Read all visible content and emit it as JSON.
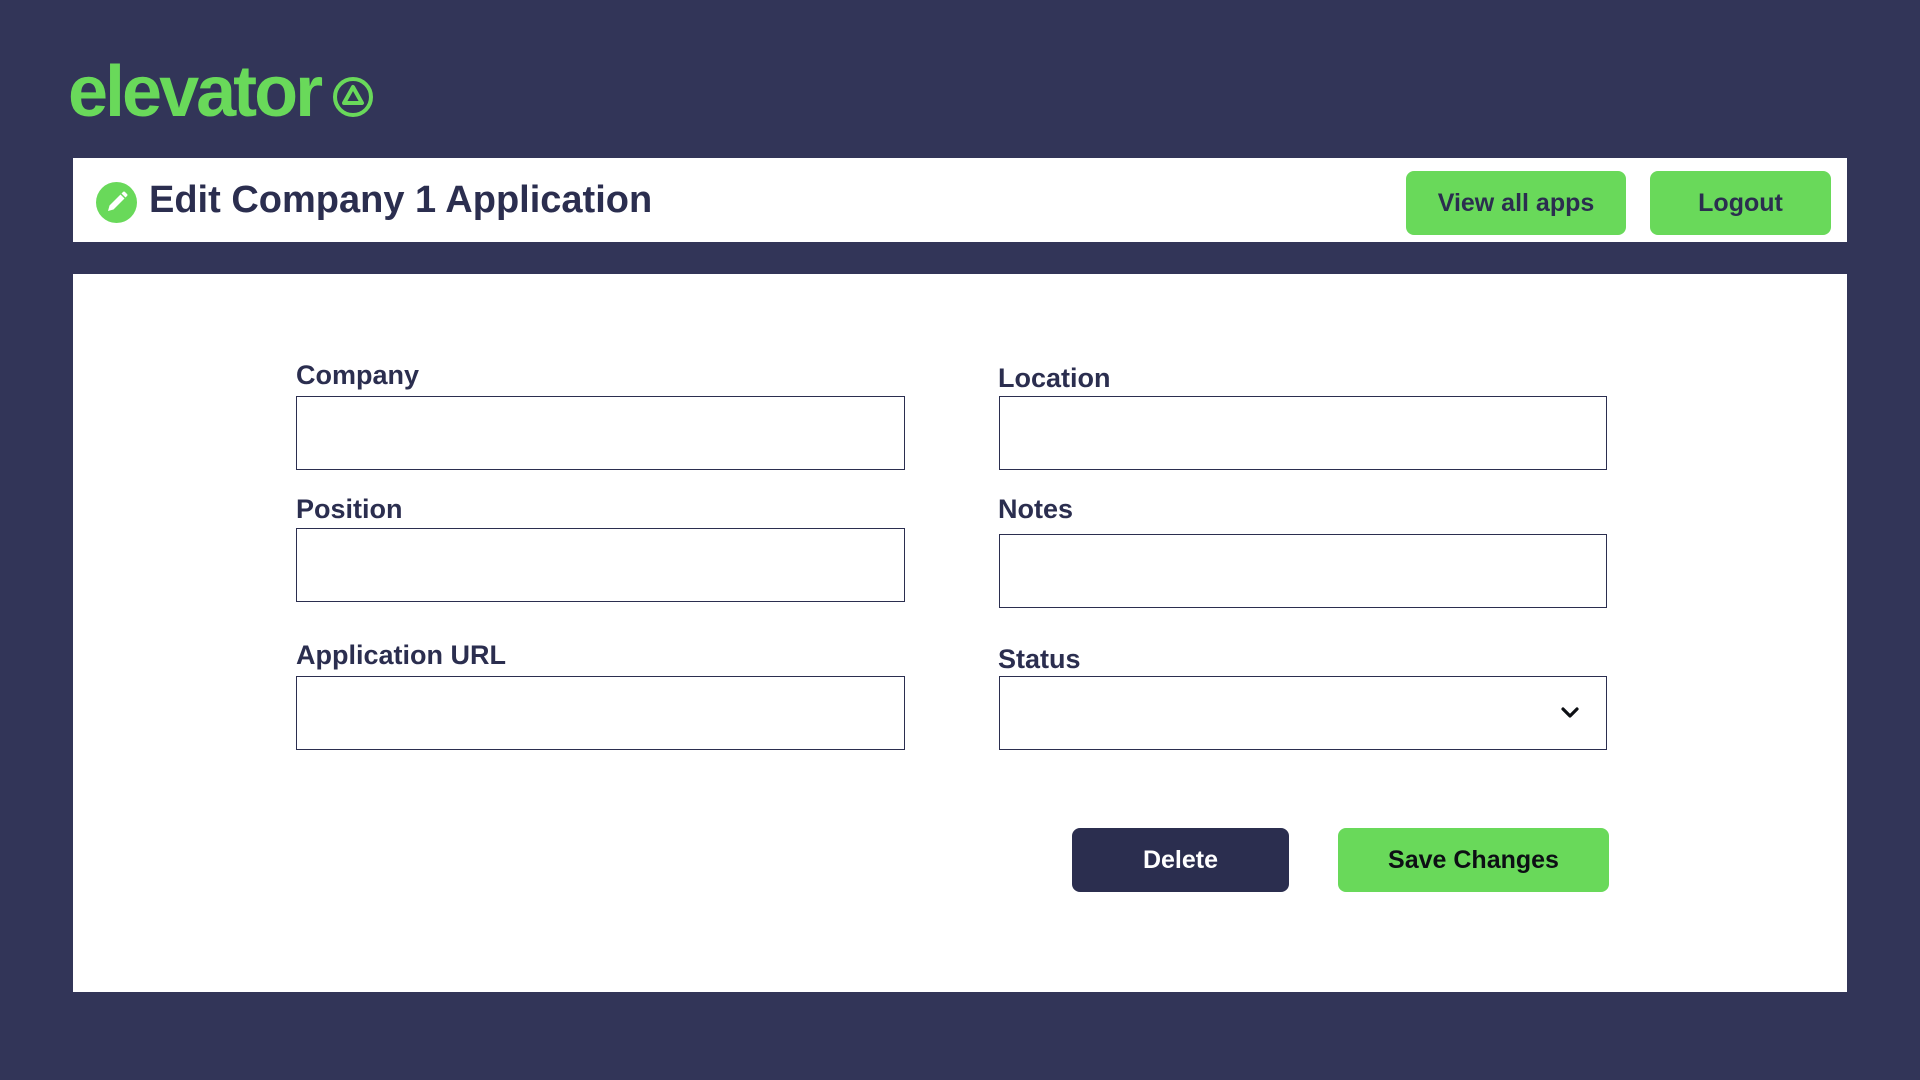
{
  "brand": {
    "name": "elevator",
    "icon": "triangle-in-circle-icon",
    "color": "#69d95a"
  },
  "colors": {
    "background": "#323558",
    "accent": "#69d95a",
    "dark": "#2b2e4f",
    "panel": "#ffffff"
  },
  "header": {
    "icon": "pencil-icon",
    "title": "Edit Company 1 Application",
    "view_all_label": "View all apps",
    "logout_label": "Logout"
  },
  "form": {
    "company": {
      "label": "Company",
      "value": "",
      "placeholder": ""
    },
    "location": {
      "label": "Location",
      "value": "",
      "placeholder": ""
    },
    "position": {
      "label": "Position",
      "value": "",
      "placeholder": ""
    },
    "notes": {
      "label": "Notes",
      "value": "",
      "placeholder": ""
    },
    "application_url": {
      "label": "Application URL",
      "value": "",
      "placeholder": ""
    },
    "status": {
      "label": "Status",
      "selected": "",
      "icon": "chevron-down-icon"
    }
  },
  "actions": {
    "delete_label": "Delete",
    "save_label": "Save Changes"
  }
}
